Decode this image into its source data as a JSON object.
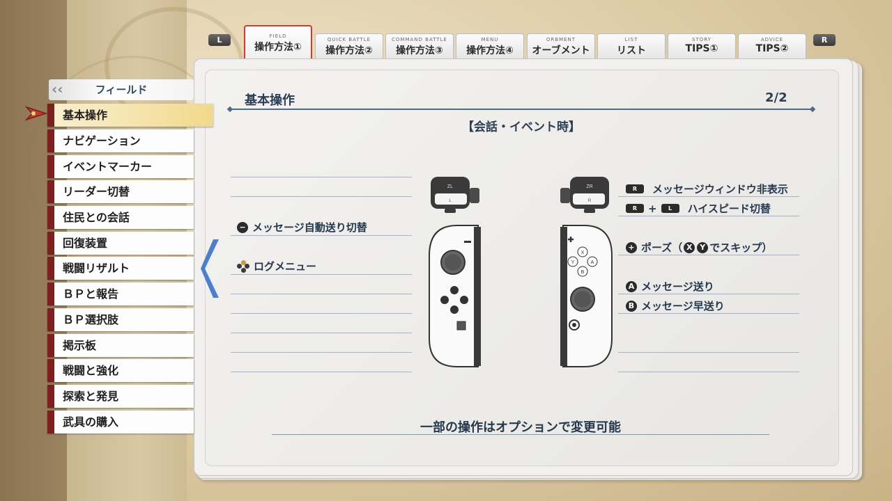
{
  "shoulders": {
    "left": "L",
    "right": "R"
  },
  "tabs": [
    {
      "sub": "FIELD",
      "label": "操作方法①",
      "active": true
    },
    {
      "sub": "QUICK BATTLE",
      "label": "操作方法②"
    },
    {
      "sub": "COMMAND BATTLE",
      "label": "操作方法③"
    },
    {
      "sub": "MENU",
      "label": "操作方法④"
    },
    {
      "sub": "ORBMENT",
      "label": "オーブメント"
    },
    {
      "sub": "LIST",
      "label": "リスト"
    },
    {
      "sub": "STORY",
      "label": "TIPS①"
    },
    {
      "sub": "ADVICE",
      "label": "TIPS②"
    }
  ],
  "sidebar": {
    "header": "フィールド",
    "items": [
      "基本操作",
      "ナビゲーション",
      "イベントマーカー",
      "リーダー切替",
      "住民との会話",
      "回復装置",
      "戦闘リザルト",
      "ＢＰと報告",
      "ＢＰ選択肢",
      "掲示板",
      "戦闘と強化",
      "探索と発見",
      "武具の購入"
    ],
    "active_index": 0
  },
  "page": {
    "title": "基本操作",
    "number": "2/2",
    "section": "【会話・イベント時】",
    "left_controls": [
      {
        "icon": "−",
        "label": "メッセージ自動送り切替"
      },
      {
        "icon": "dpad",
        "label": "ログメニュー"
      }
    ],
    "right_controls": [
      {
        "keys": [
          "R"
        ],
        "label": "メッセージウィンドウ非表示"
      },
      {
        "keys": [
          "R",
          "L"
        ],
        "joiner": "+",
        "label": "ハイスピード切替"
      },
      {
        "icon": "+",
        "label": "ポーズ（",
        "x": "X",
        "y": "Y",
        "suffix": "でスキップ）"
      },
      {
        "icon": "A",
        "label": "メッセージ送り"
      },
      {
        "icon": "B",
        "label": "メッセージ早送り"
      }
    ],
    "footer": "一部の操作はオプションで変更可能"
  },
  "controller_labels": {
    "zl": "ZL",
    "l": "L",
    "zr": "ZR",
    "r": "R",
    "x": "X",
    "y": "Y",
    "a": "A",
    "b": "B"
  }
}
